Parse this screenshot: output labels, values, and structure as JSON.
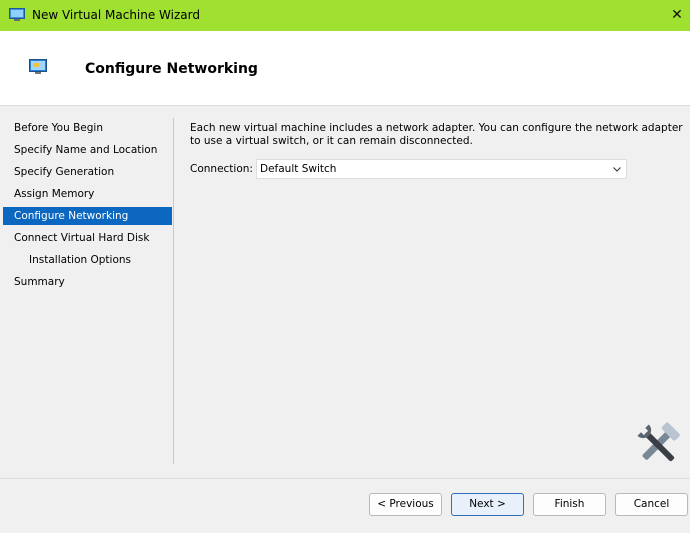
{
  "window": {
    "title": "New Virtual Machine Wizard",
    "close_glyph": "✕",
    "titlebar_color": "#9fe030"
  },
  "header": {
    "title": "Configure Networking",
    "icon": "network-adapter-icon"
  },
  "nav": {
    "items": [
      {
        "label": "Before You Begin",
        "active": false
      },
      {
        "label": "Specify Name and Location",
        "active": false
      },
      {
        "label": "Specify Generation",
        "active": false
      },
      {
        "label": "Assign Memory",
        "active": false
      },
      {
        "label": "Configure Networking",
        "active": true
      },
      {
        "label": "Connect Virtual Hard Disk",
        "active": false
      },
      {
        "label": "Installation Options",
        "active": false
      },
      {
        "label": "Summary",
        "active": false
      }
    ],
    "active_color": "#0c67c0"
  },
  "content": {
    "description": "Each new virtual machine includes a network adapter. You can configure the network adapter to use a virtual switch, or it can remain disconnected.",
    "connection_label": "Connection:",
    "connection_value": "Default Switch"
  },
  "buttons": {
    "previous": "< Previous",
    "next": "Next >",
    "finish": "Finish",
    "cancel": "Cancel"
  }
}
